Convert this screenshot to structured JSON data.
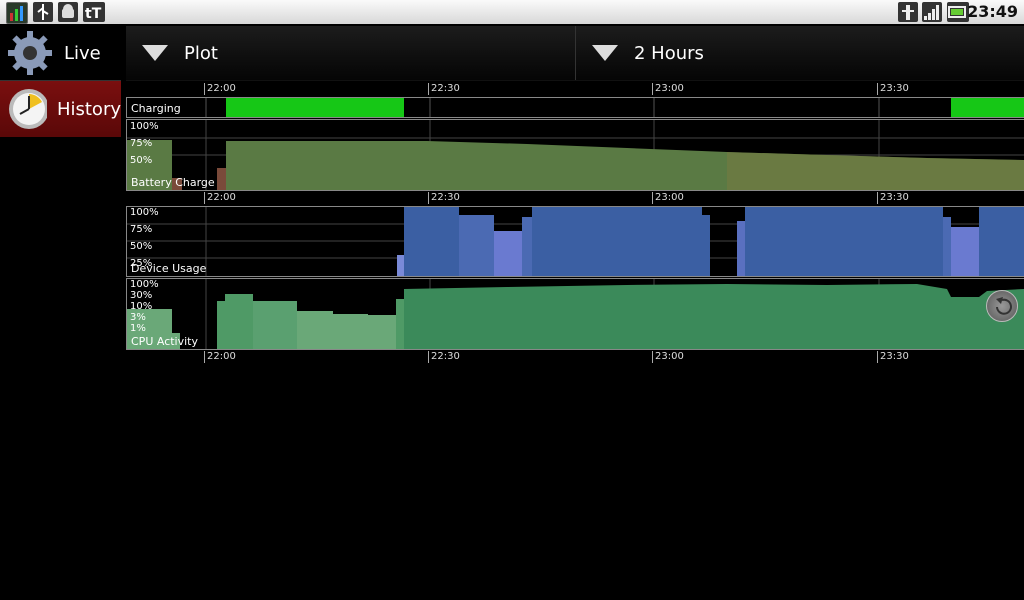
{
  "status_bar": {
    "clock": "23:49",
    "left_icons": [
      "graph-icon",
      "usb-icon",
      "android-icon",
      "text-tt-icon"
    ],
    "right_icons": [
      "wifi-icon",
      "signal-icon",
      "battery-charging-icon"
    ]
  },
  "sidebar": {
    "items": [
      {
        "label": "Live",
        "icon": "gear-icon",
        "selected": false
      },
      {
        "label": "History",
        "icon": "clock-icon",
        "selected": true
      }
    ]
  },
  "toolbar": {
    "plot_label": "Plot",
    "range_label": "2 Hours"
  },
  "time_axis": {
    "ticks": [
      "22:00",
      "22:30",
      "23:00",
      "23:30"
    ]
  },
  "panels": {
    "charging": {
      "label": "Charging"
    },
    "battery": {
      "label": "Battery Charge",
      "y_labels": [
        "100%",
        "75%",
        "50%"
      ]
    },
    "device": {
      "label": "Device Usage",
      "y_labels": [
        "100%",
        "75%",
        "50%",
        "25%"
      ]
    },
    "cpu": {
      "label": "CPU Activity",
      "y_labels": [
        "100%",
        "30%",
        "10%",
        "3%",
        "1%"
      ]
    }
  },
  "colors": {
    "charging": "#16c716",
    "battery": "#5a7a44",
    "device": "#3b5fa3",
    "cpu": "#3b8a5a"
  }
}
